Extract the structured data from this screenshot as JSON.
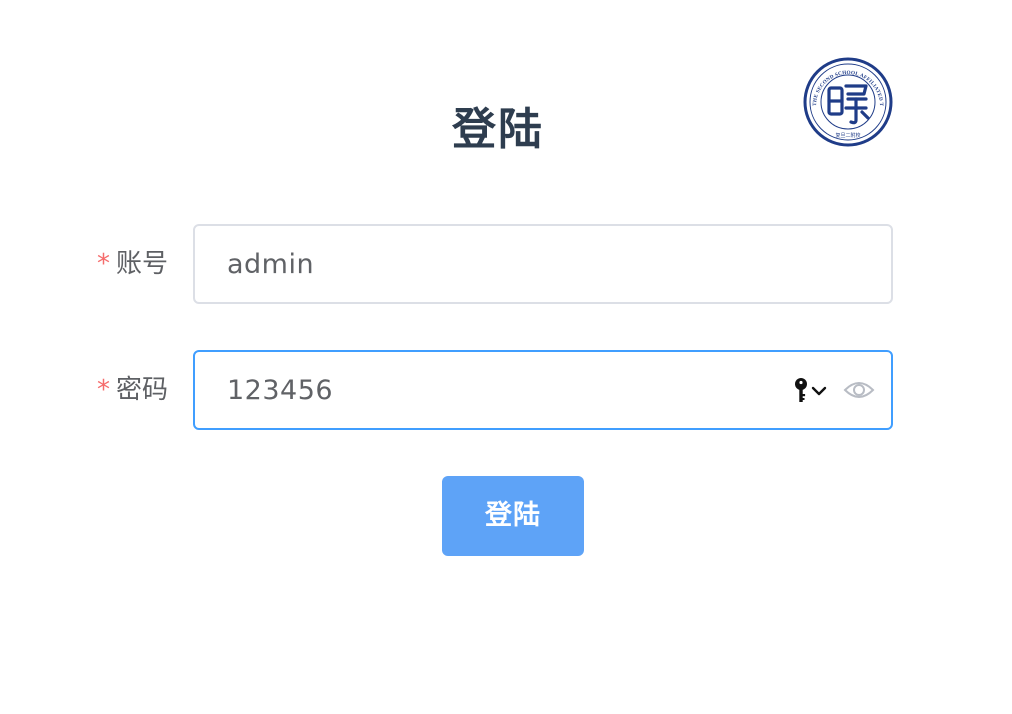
{
  "header": {
    "title": "登陆",
    "logo_text_top": "THE SECOND SCHOOL AFFILIATED TO FUDAN UNIVERSITY",
    "logo_text_bottom": "复旦二附校",
    "logo_color": "#1f3c88"
  },
  "form": {
    "account": {
      "required_mark": "*",
      "label": "账号",
      "value": "admin"
    },
    "password": {
      "required_mark": "*",
      "label": "密码",
      "value": "123456",
      "icons": [
        "key-icon",
        "chevron-down-icon",
        "eye-icon"
      ]
    },
    "submit_label": "登陆"
  },
  "colors": {
    "primary": "#409eff",
    "button": "#5ea3f7",
    "required": "#f56c6c",
    "title": "#2e3d4f"
  }
}
